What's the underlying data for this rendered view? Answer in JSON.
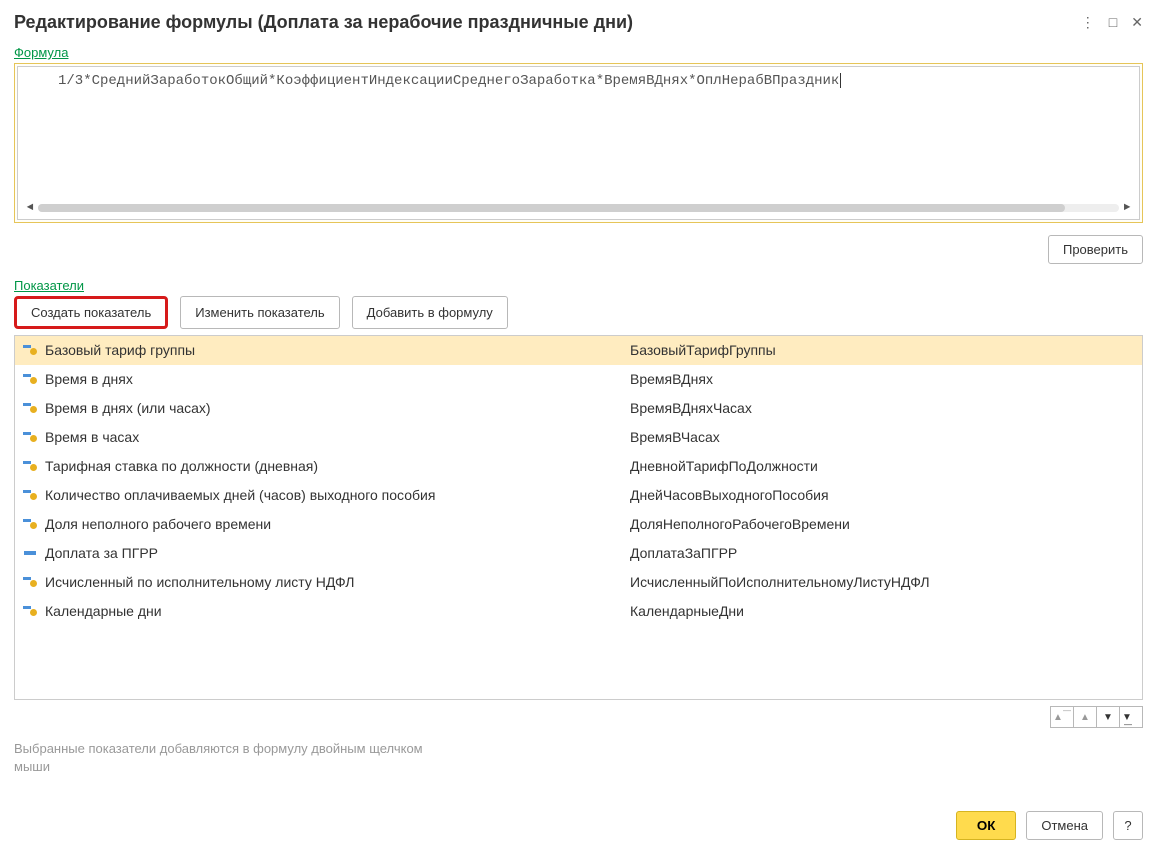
{
  "window": {
    "title": "Редактирование формулы (Доплата за нерабочие праздничные дни)"
  },
  "formula": {
    "label": "Формула",
    "text": "1/3*СреднийЗаработокОбщий*КоэффициентИндексацииСреднегоЗаработка*ВремяВДнях*ОплНерабВПраздник"
  },
  "buttons": {
    "check": "Проверить",
    "create": "Создать показатель",
    "edit": "Изменить показатель",
    "add": "Добавить в формулу",
    "ok": "ОК",
    "cancel": "Отмена",
    "help": "?"
  },
  "indicators": {
    "label": "Показатели",
    "rows": [
      {
        "name": "Базовый тариф группы",
        "code": "БазовыйТарифГруппы",
        "iconType": "dotted",
        "selected": true
      },
      {
        "name": "Время в днях",
        "code": "ВремяВДнях",
        "iconType": "dotted",
        "selected": false
      },
      {
        "name": "Время в днях (или часах)",
        "code": "ВремяВДняхЧасах",
        "iconType": "dotted",
        "selected": false
      },
      {
        "name": "Время в часах",
        "code": "ВремяВЧасах",
        "iconType": "dotted",
        "selected": false
      },
      {
        "name": "Тарифная ставка по должности (дневная)",
        "code": "ДневнойТарифПоДолжности",
        "iconType": "dotted",
        "selected": false
      },
      {
        "name": "Количество оплачиваемых дней (часов) выходного пособия",
        "code": "ДнейЧасовВыходногоПособия",
        "iconType": "dotted",
        "selected": false
      },
      {
        "name": "Доля неполного рабочего времени",
        "code": "ДоляНеполногоРабочегоВремени",
        "iconType": "dotted",
        "selected": false
      },
      {
        "name": "Доплата за ПГРР",
        "code": "ДоплатаЗаПГРР",
        "iconType": "plain",
        "selected": false
      },
      {
        "name": "Исчисленный по исполнительному листу НДФЛ",
        "code": "ИсчисленныйПоИсполнительномуЛистуНДФЛ",
        "iconType": "dotted",
        "selected": false
      },
      {
        "name": "Календарные дни",
        "code": "КалендарныеДни",
        "iconType": "dotted",
        "selected": false
      }
    ]
  },
  "hint": "Выбранные показатели добавляются в формулу двойным щелчком мыши"
}
